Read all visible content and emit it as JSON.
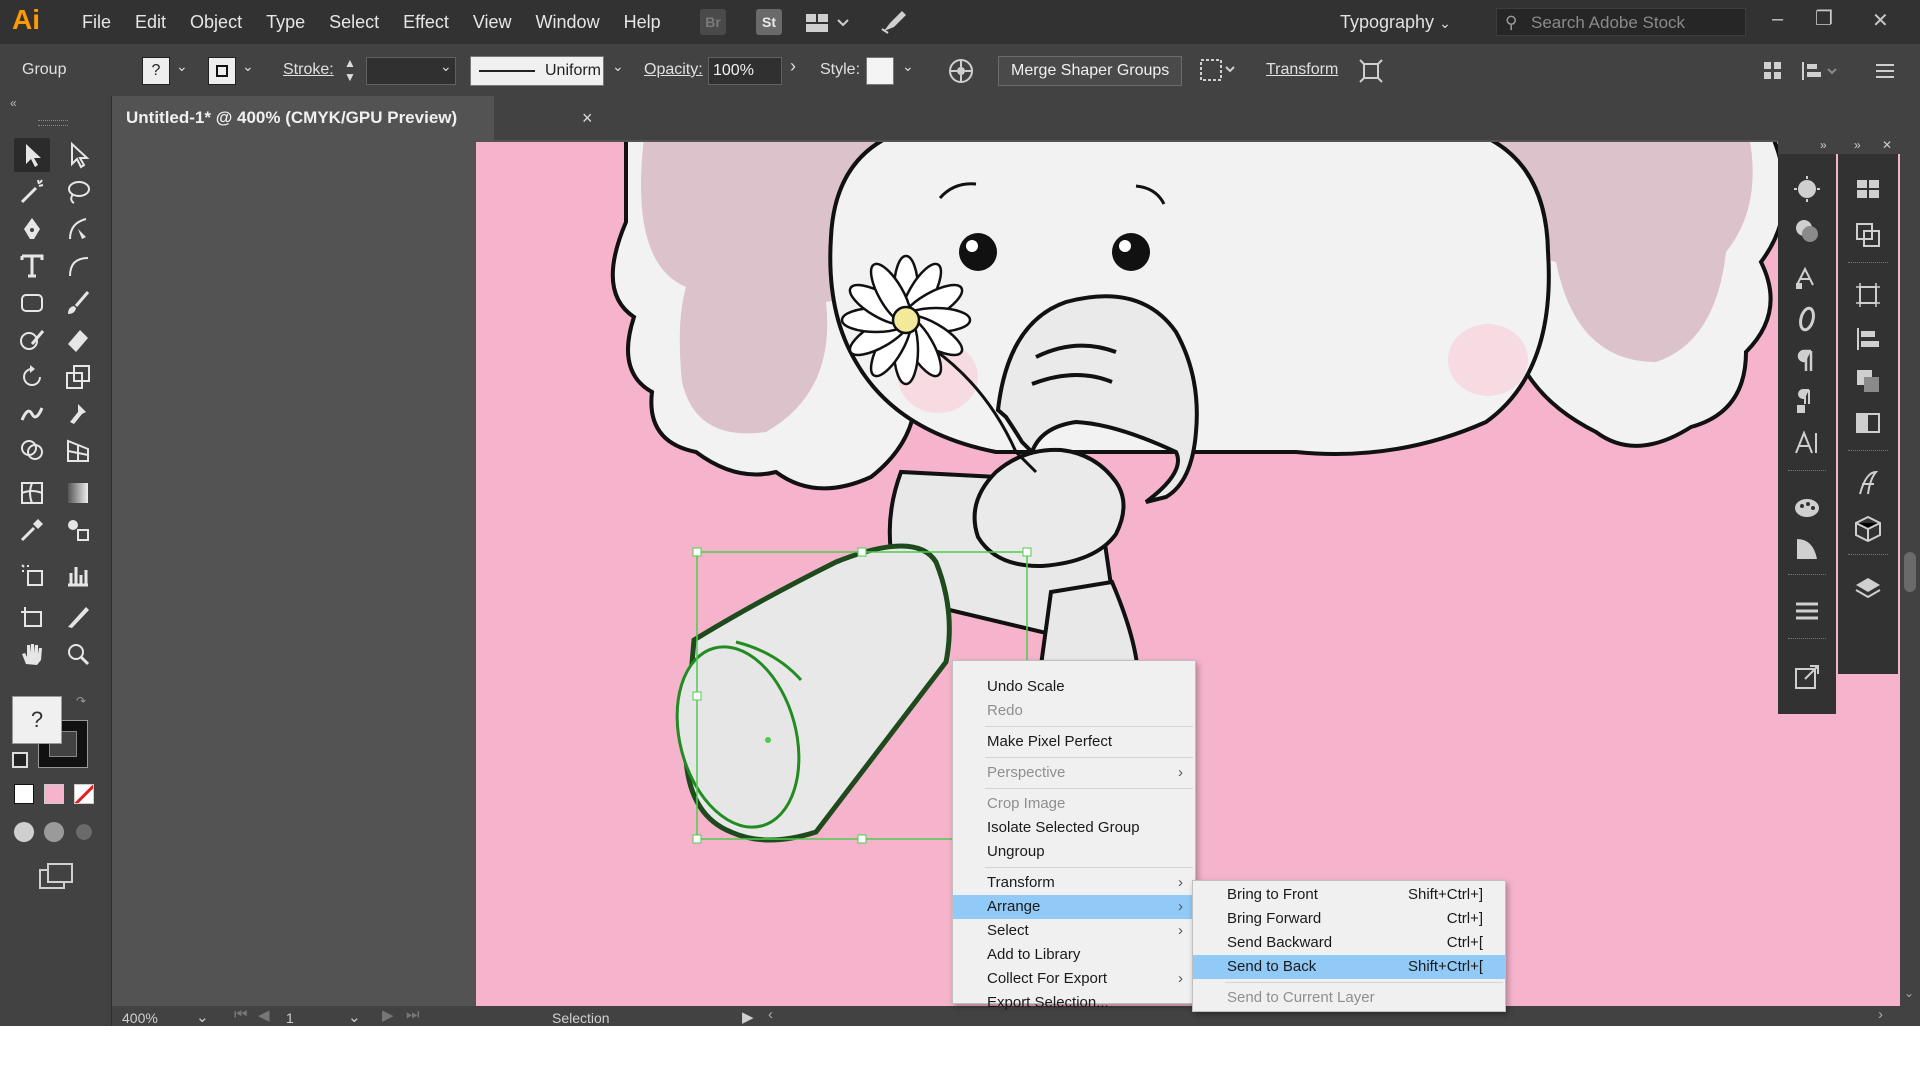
{
  "app": {
    "logo": "Ai",
    "workspace": "Typography",
    "search_placeholder": "Search Adobe Stock"
  },
  "menu": [
    "File",
    "Edit",
    "Object",
    "Type",
    "Select",
    "Effect",
    "View",
    "Window",
    "Help"
  ],
  "menubar_icons": {
    "bridge": "Br",
    "stock": "St"
  },
  "control_bar": {
    "selection_type": "Group",
    "fill_label": "?",
    "stroke_label": "Stroke:",
    "stroke_profile": "Uniform",
    "opacity_label": "Opacity:",
    "opacity_value": "100%",
    "style_label": "Style:",
    "merge_button": "Merge Shaper Groups",
    "transform_link": "Transform"
  },
  "document_tab": {
    "title": "Untitled-1* @ 400% (CMYK/GPU Preview)",
    "close": "×"
  },
  "toolbar": {
    "fill_question": "?"
  },
  "status_bar": {
    "zoom": "400%",
    "artboard_number": "1",
    "tool": "Selection"
  },
  "context_menu": {
    "undo": "Undo Scale",
    "redo": "Redo",
    "pixel_perfect": "Make Pixel Perfect",
    "perspective": "Perspective",
    "crop_image": "Crop Image",
    "isolate": "Isolate Selected Group",
    "ungroup": "Ungroup",
    "transform": "Transform",
    "arrange": "Arrange",
    "select": "Select",
    "add_to_library": "Add to Library",
    "collect_export": "Collect For Export",
    "export_selection": "Export Selection..."
  },
  "arrange_submenu": {
    "bring_front": "Bring to Front",
    "bring_front_sc": "Shift+Ctrl+]",
    "bring_forward": "Bring Forward",
    "bring_forward_sc": "Ctrl+]",
    "send_backward": "Send Backward",
    "send_backward_sc": "Ctrl+[",
    "send_back": "Send to Back",
    "send_back_sc": "Shift+Ctrl+[",
    "send_current_layer": "Send to Current Layer"
  },
  "colors": {
    "artboard": "#f6b4cc",
    "menu_highlight": "#91c9f7",
    "accent": "#ff9a00",
    "selection": "#4dcc4d"
  }
}
